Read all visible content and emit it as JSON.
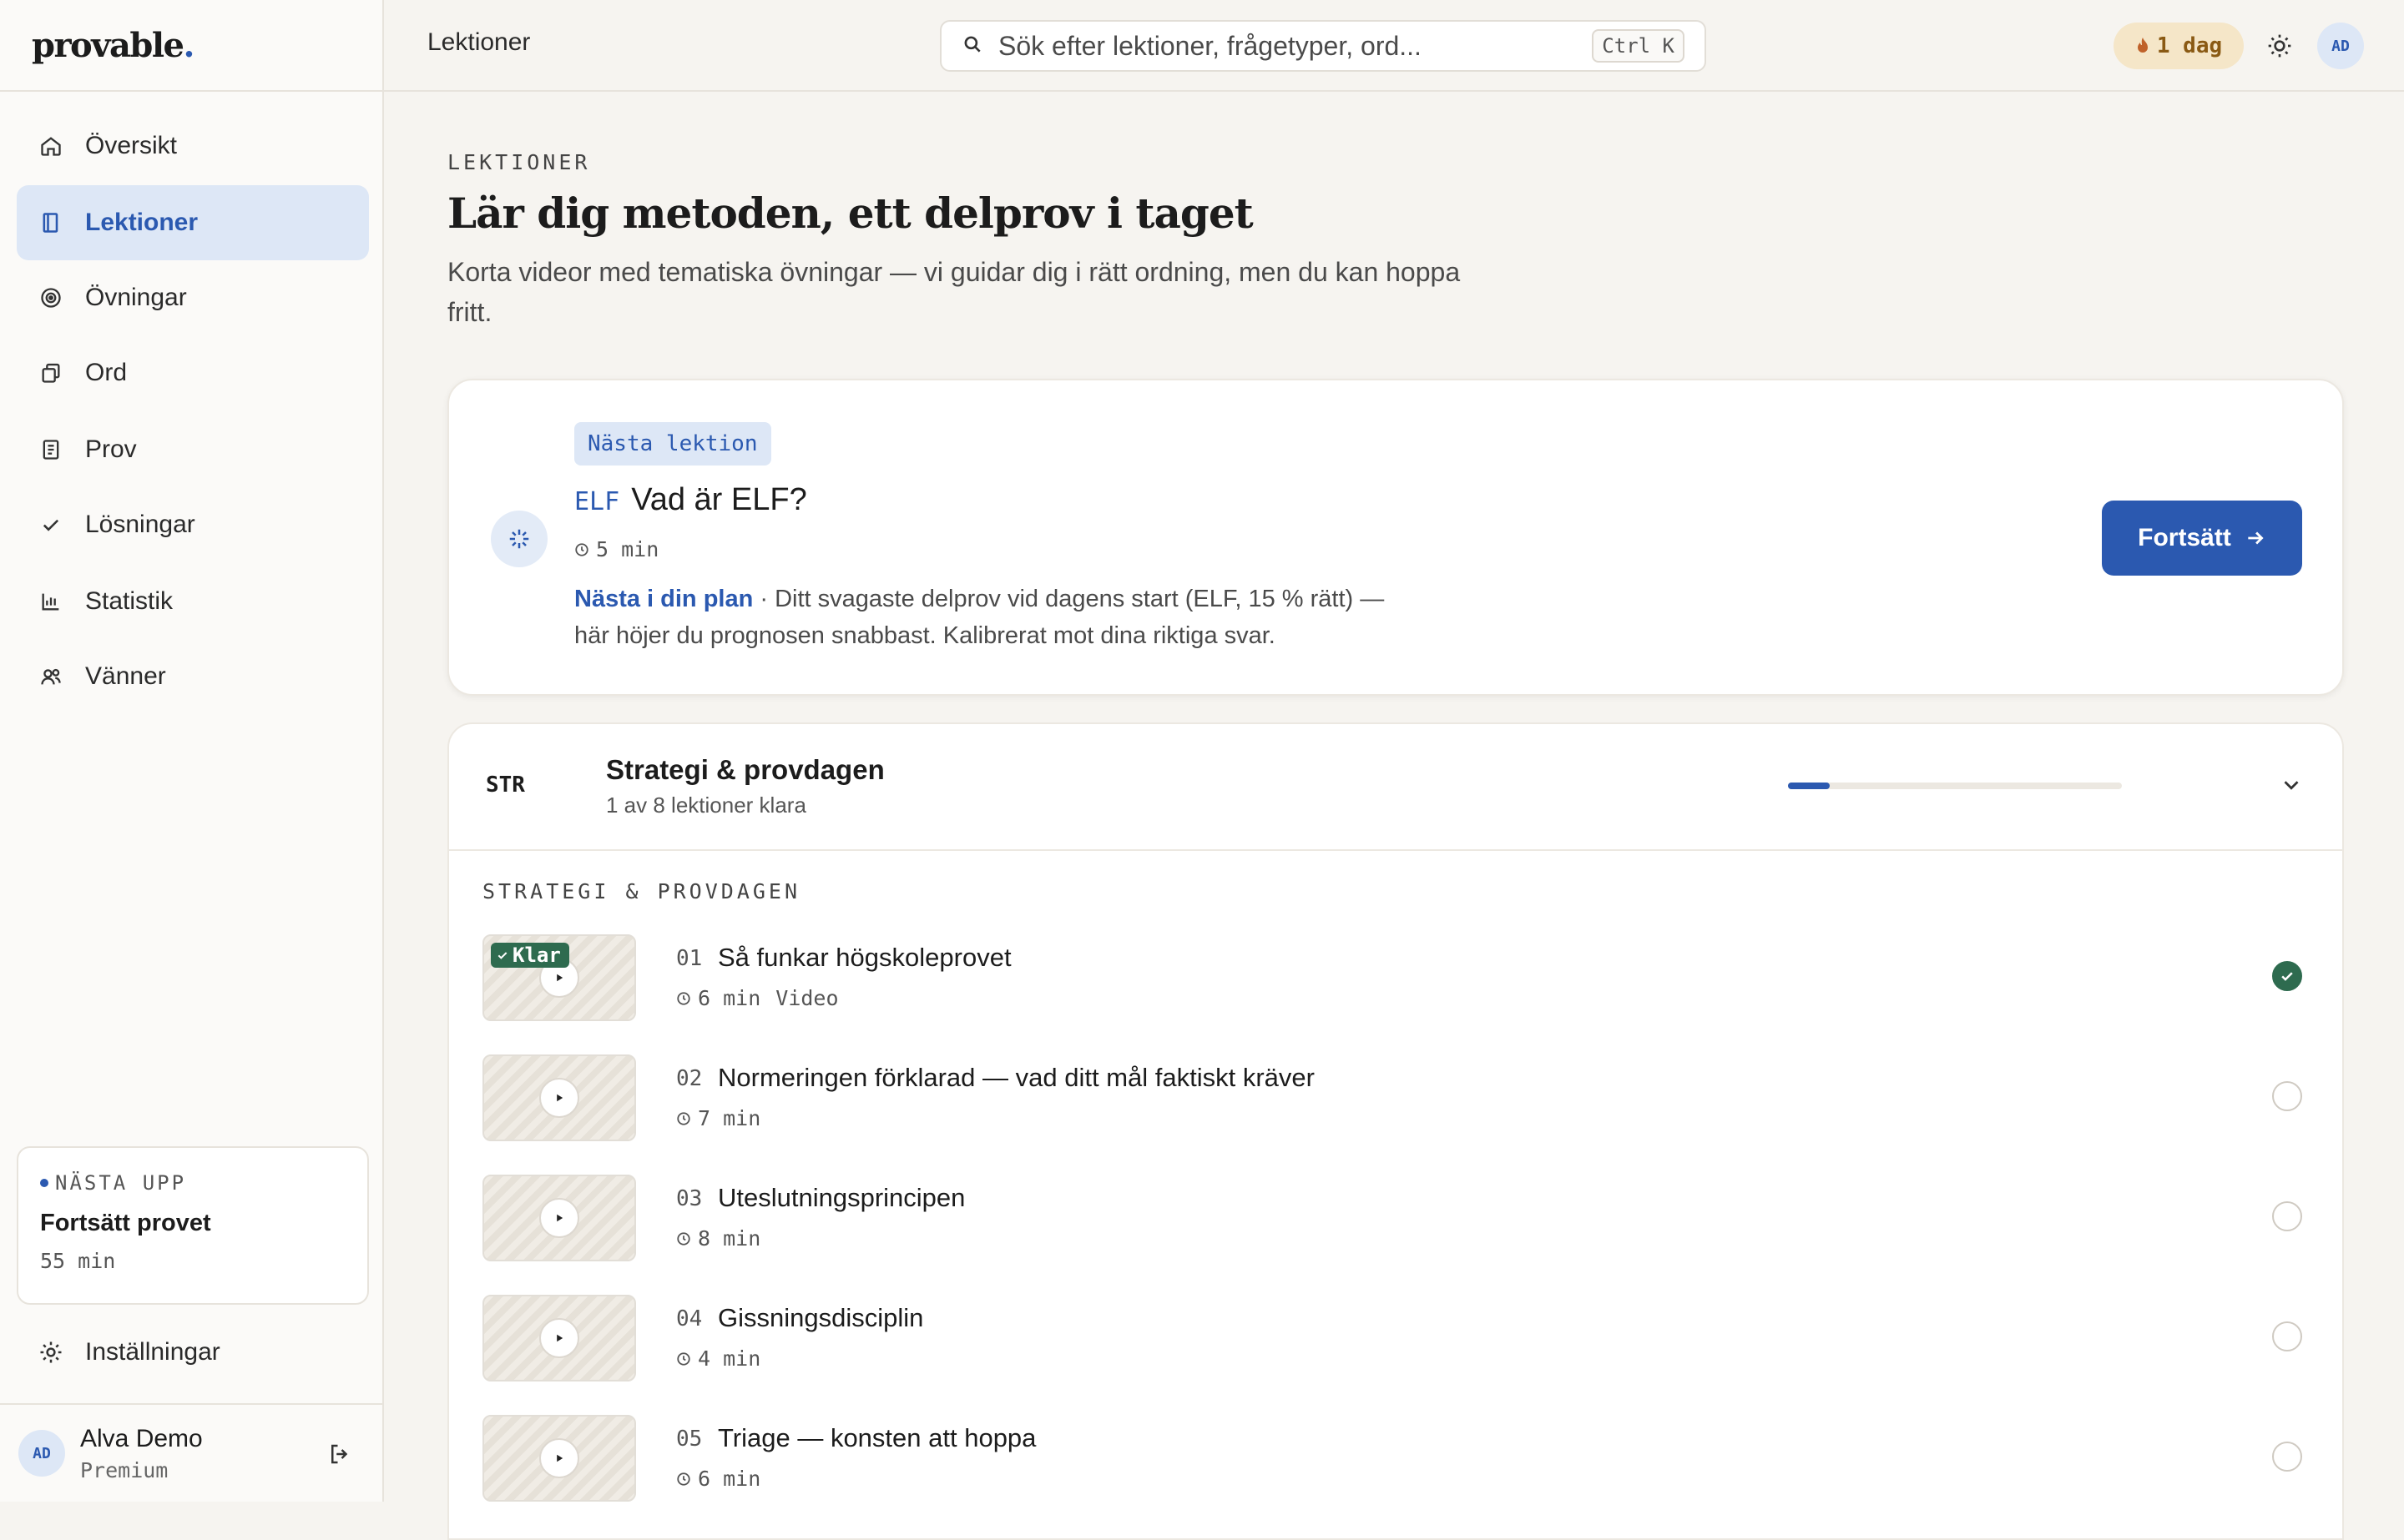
{
  "brand": {
    "logo_text": "provable",
    "logo_dot": "."
  },
  "sidebar": {
    "items": [
      {
        "label": "Översikt",
        "icon": "home-icon"
      },
      {
        "label": "Lektioner",
        "icon": "book-icon",
        "active": true
      },
      {
        "label": "Övningar",
        "icon": "target-icon"
      },
      {
        "label": "Ord",
        "icon": "cards-icon"
      },
      {
        "label": "Prov",
        "icon": "document-icon"
      },
      {
        "label": "Lösningar",
        "icon": "check-icon"
      },
      {
        "label": "Statistik",
        "icon": "bar-chart-icon"
      },
      {
        "label": "Vänner",
        "icon": "users-icon"
      }
    ],
    "next_up": {
      "heading": "NÄSTA UPP",
      "title": "Fortsätt provet",
      "time": "55 min"
    },
    "settings_label": "Inställningar",
    "user": {
      "initials": "AD",
      "name": "Alva Demo",
      "plan": "Premium"
    }
  },
  "topbar": {
    "title": "Lektioner",
    "search_placeholder": "Sök efter lektioner, frågetyper, ord...",
    "shortcut": "Ctrl K",
    "streak": "1 dag",
    "avatar_initials": "AD"
  },
  "page": {
    "eyebrow": "LEKTIONER",
    "title": "Lär dig metoden, ett delprov i taget",
    "description": "Korta videor med tematiska övningar — vi guidar dig i rätt ordning, men du kan hoppa fritt."
  },
  "next_lesson": {
    "badge": "Nästa lektion",
    "code": "ELF",
    "title": "Vad är ELF?",
    "duration": "5 min",
    "link_text": "Nästa i din plan",
    "body": " · Ditt svagaste delprov vid dagens start (ELF, 15 % rätt) — här höjer du prognosen snabbast. Kalibrerat mot dina riktiga svar.",
    "button_label": "Fortsätt"
  },
  "module": {
    "code": "STR",
    "title": "Strategi & provdagen",
    "progress_text": "1 av 8 lektioner klara",
    "progress": 0.125,
    "section_label": "STRATEGI & PROVDAGEN",
    "lessons": [
      {
        "num": "01",
        "title": "Så funkar högskoleprovet",
        "duration": "6 min",
        "type": "Video",
        "done": true,
        "badge": "Klar"
      },
      {
        "num": "02",
        "title": "Normeringen förklarad — vad ditt mål faktiskt kräver",
        "duration": "7 min",
        "done": false
      },
      {
        "num": "03",
        "title": "Uteslutningsprincipen",
        "duration": "8 min",
        "done": false
      },
      {
        "num": "04",
        "title": "Gissningsdisciplin",
        "duration": "4 min",
        "done": false
      },
      {
        "num": "05",
        "title": "Triage — konsten att hoppa",
        "duration": "6 min",
        "done": false
      }
    ]
  },
  "colors": {
    "accent": "#2b59b0",
    "success": "#2e6b4f",
    "background": "#f6f4f0",
    "streak_bg": "#f5e6c8"
  }
}
